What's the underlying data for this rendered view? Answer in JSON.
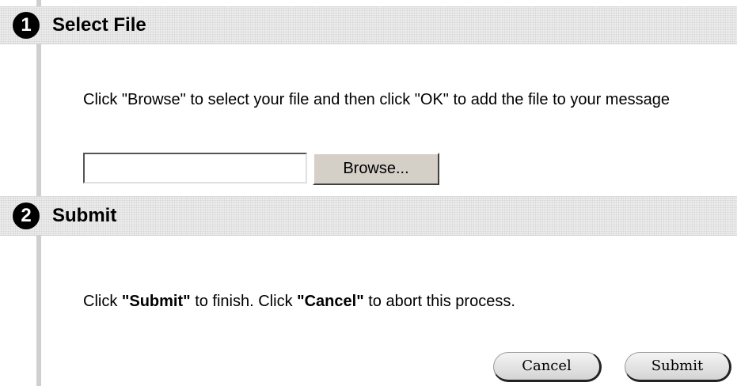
{
  "steps": [
    {
      "number": "1",
      "title": "Select File",
      "instruction": "Click \"Browse\" to select your file and then click \"OK\" to add the file to your message"
    },
    {
      "number": "2",
      "title": "Submit",
      "instruction_parts": {
        "p1": "Click ",
        "b1": "\"Submit\"",
        "p2": " to finish. Click ",
        "b2": "\"Cancel\"",
        "p3": " to abort this process."
      }
    }
  ],
  "file_input": {
    "value": "",
    "placeholder": ""
  },
  "buttons": {
    "browse": "Browse...",
    "cancel": "Cancel",
    "submit": "Submit"
  },
  "colors": {
    "header_bg": "#ececec",
    "step_rail": "#cfcfcf",
    "badge": "#000000"
  }
}
